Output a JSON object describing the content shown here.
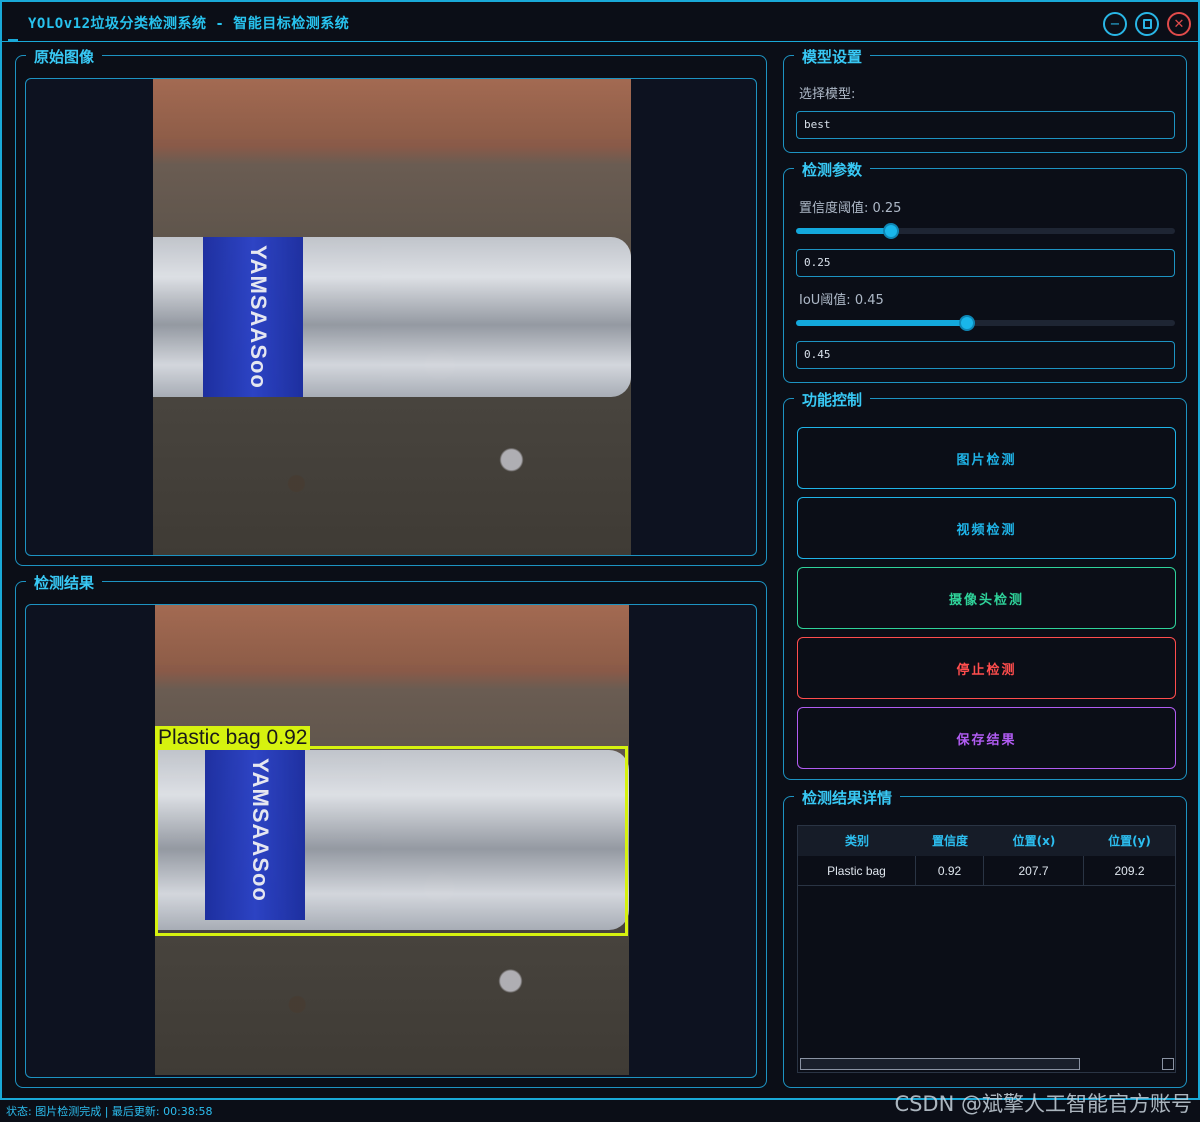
{
  "window": {
    "title": "YOLOv12垃圾分类检测系统 - 智能目标检测系统",
    "minimize_icon": "minimize-icon",
    "maximize_icon": "maximize-icon",
    "close_icon": "close-icon"
  },
  "original_panel": {
    "title": "原始图像",
    "bottle_label": "YAMSAASoo"
  },
  "result_panel": {
    "title": "检测结果",
    "detection_label": "Plastic bag 0.92",
    "box_color": "#d6f20f"
  },
  "model_settings": {
    "title": "模型设置",
    "select_label": "选择模型:",
    "selected_model": "best"
  },
  "detect_params": {
    "title": "检测参数",
    "conf_label": "置信度阈值: 0.25",
    "conf_value": "0.25",
    "conf_fraction": 0.25,
    "iou_label": "IoU阈值: 0.45",
    "iou_value": "0.45",
    "iou_fraction": 0.45
  },
  "controls": {
    "title": "功能控制",
    "image_detect": "图片检测",
    "video_detect": "视频检测",
    "camera_detect": "摄像头检测",
    "stop_detect": "停止检测",
    "save_results": "保存结果",
    "colors": {
      "image": "#1fb4e8",
      "video": "#1fb4e8",
      "camera": "#2fd39a",
      "stop": "#ff4d4d",
      "save": "#b15cf2"
    }
  },
  "details": {
    "title": "检测结果详情",
    "columns": [
      "类别",
      "置信度",
      "位置(x)",
      "位置(y)"
    ],
    "rows": [
      [
        "Plastic bag",
        "0.92",
        "207.7",
        "209.2"
      ]
    ]
  },
  "status": {
    "text": "状态: 图片检测完成 | 最后更新: 00:38:58"
  },
  "watermark": "CSDN @斌擎人工智能官方账号"
}
